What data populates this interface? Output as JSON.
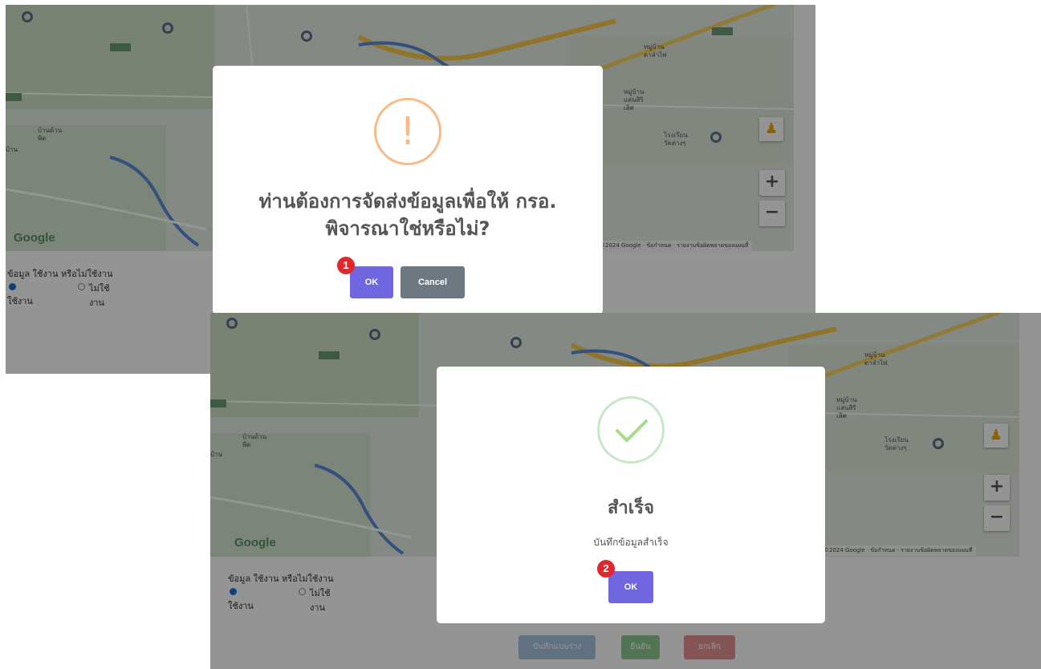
{
  "map": {
    "google_logo": "Google",
    "attribution": "©2024 Google · ข้อกำหนด · รายงานข้อผิดพลาดของแผนที่",
    "zoom_in": "+",
    "zoom_out": "−",
    "pegman": "♟",
    "labels": {
      "village_1": "หมู่บ้าน\nตาลำไพ่",
      "village_2": "หมู่บ้าน\nแสนสิริ\nเลิศ",
      "wat": "โรงเรียน\nวัดต่างๆ",
      "ban_muang": "บ้านด้วน\nพิต",
      "school": "โรงเรียน",
      "ban": "บ้าน"
    }
  },
  "form": {
    "question": "ข้อมูล ใช้งาน หรือไม่ใช้งาน",
    "option_use": "ใช้งาน",
    "option_not_use": "ไม่ใช้งาน"
  },
  "dialog_confirm": {
    "icon": "!",
    "title": "ท่านต้องการจัดส่งข้อมูลเพื่อให้ กรอ. พิจารณาใช่หรือไม่?",
    "ok": "OK",
    "cancel": "Cancel",
    "step": "1"
  },
  "dialog_success": {
    "title": "สำเร็จ",
    "text": "บันทึกข้อมูลสำเร็จ",
    "ok": "OK",
    "step": "2"
  },
  "bottom_buttons": {
    "save_draft": "บันทึกแบบร่าง",
    "confirm": "ยืนยัน",
    "cancel": "ยกเลิก"
  },
  "colors": {
    "ok_button": "#7066e0",
    "cancel_button": "#6e7881",
    "warning": "#f8bb86",
    "success": "#a5dc86",
    "badge": "#e2272c"
  }
}
